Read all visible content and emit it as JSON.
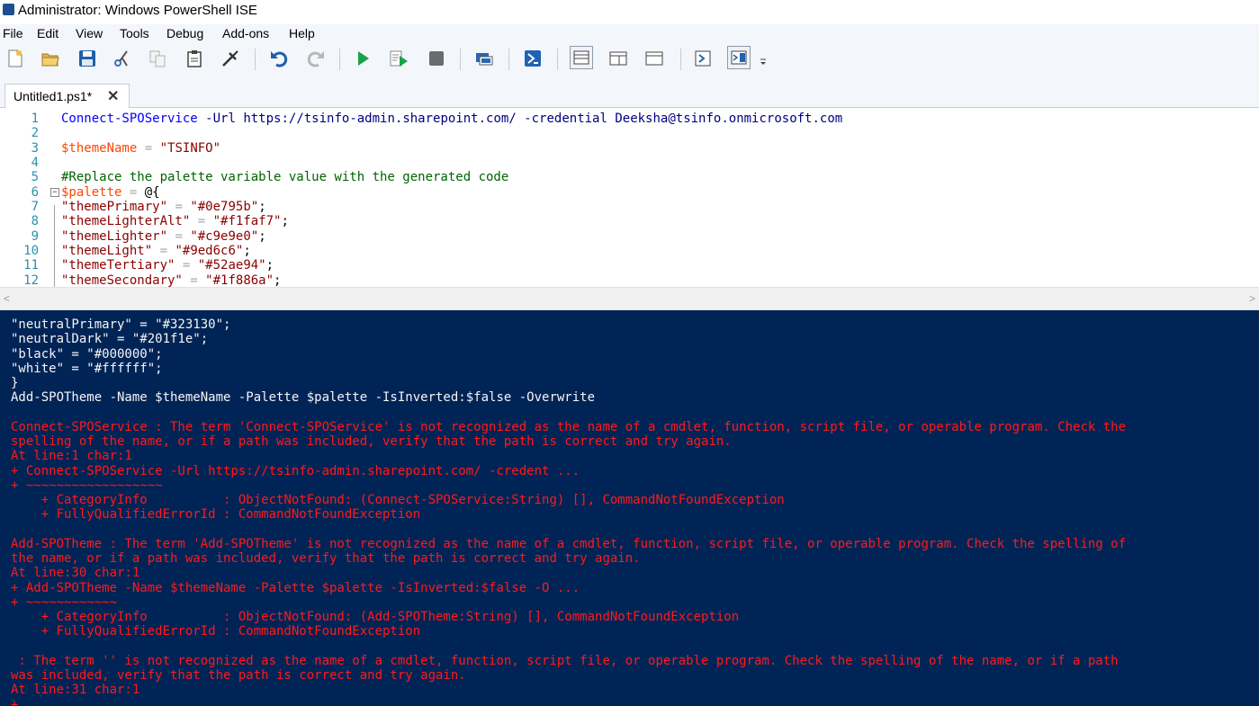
{
  "window": {
    "title": "Administrator: Windows PowerShell ISE"
  },
  "menu": [
    "File",
    "Edit",
    "View",
    "Tools",
    "Debug",
    "Add-ons",
    "Help"
  ],
  "toolbar": {
    "icons": [
      "new-script",
      "open",
      "save",
      "cut",
      "copy",
      "paste",
      "clear-console",
      "undo",
      "redo",
      "run-script",
      "run-selection",
      "stop-operation",
      "new-remote-powershell-tab",
      "start-powershell-exe",
      "show-script-pane-top",
      "show-script-pane-right",
      "show-script-pane-maximized",
      "show-command-window",
      "show-command-add-on",
      "toolbar-overflow"
    ],
    "colors": {
      "run": "#1aa14a",
      "save": "#1f5fa6",
      "stop": "#6b6b6b"
    }
  },
  "tabs": [
    {
      "label": "Untitled1.ps1*",
      "close": "✕"
    }
  ],
  "editor": {
    "colors": {
      "cmdlet": "#0000ff",
      "parameter": "#000080",
      "string": "#8b0000",
      "variable": "#ff4500",
      "comment": "#006400",
      "operator": "#a9a9a9",
      "text": "#000000"
    },
    "lines": [
      {
        "n": "1",
        "tokens": [
          {
            "t": "Connect-SPOService",
            "c": "cmdlet"
          },
          {
            "t": " "
          },
          {
            "t": "-Url",
            "c": "parameter"
          },
          {
            "t": " "
          },
          {
            "t": "https://tsinfo-admin.sharepoint.com/",
            "c": "parameter"
          },
          {
            "t": " "
          },
          {
            "t": "-credential",
            "c": "parameter"
          },
          {
            "t": " "
          },
          {
            "t": "Deeksha@tsinfo.onmicrosoft.com",
            "c": "parameter"
          }
        ]
      },
      {
        "n": "2",
        "tokens": []
      },
      {
        "n": "3",
        "tokens": [
          {
            "t": "$themeName",
            "c": "variable"
          },
          {
            "t": " "
          },
          {
            "t": "=",
            "c": "operator"
          },
          {
            "t": " "
          },
          {
            "t": "\"TSINFO\"",
            "c": "string"
          }
        ]
      },
      {
        "n": "4",
        "tokens": []
      },
      {
        "n": "5",
        "tokens": [
          {
            "t": "#Replace the palette variable value with the generated code",
            "c": "comment"
          }
        ]
      },
      {
        "n": "6",
        "fold": "−",
        "tokens": [
          {
            "t": "$palette",
            "c": "variable"
          },
          {
            "t": " "
          },
          {
            "t": "=",
            "c": "operator"
          },
          {
            "t": " "
          },
          {
            "t": "@{",
            "c": "text"
          }
        ]
      },
      {
        "n": "7",
        "tokens": [
          {
            "t": "\"themePrimary\"",
            "c": "string"
          },
          {
            "t": " "
          },
          {
            "t": "=",
            "c": "operator"
          },
          {
            "t": " "
          },
          {
            "t": "\"#0e795b\"",
            "c": "string"
          },
          {
            "t": ";",
            "c": "text"
          }
        ]
      },
      {
        "n": "8",
        "tokens": [
          {
            "t": "\"themeLighterAlt\"",
            "c": "string"
          },
          {
            "t": " "
          },
          {
            "t": "=",
            "c": "operator"
          },
          {
            "t": " "
          },
          {
            "t": "\"#f1faf7\"",
            "c": "string"
          },
          {
            "t": ";",
            "c": "text"
          }
        ]
      },
      {
        "n": "9",
        "tokens": [
          {
            "t": "\"themeLighter\"",
            "c": "string"
          },
          {
            "t": " "
          },
          {
            "t": "=",
            "c": "operator"
          },
          {
            "t": " "
          },
          {
            "t": "\"#c9e9e0\"",
            "c": "string"
          },
          {
            "t": ";",
            "c": "text"
          }
        ]
      },
      {
        "n": "10",
        "tokens": [
          {
            "t": "\"themeLight\"",
            "c": "string"
          },
          {
            "t": " "
          },
          {
            "t": "=",
            "c": "operator"
          },
          {
            "t": " "
          },
          {
            "t": "\"#9ed6c6\"",
            "c": "string"
          },
          {
            "t": ";",
            "c": "text"
          }
        ]
      },
      {
        "n": "11",
        "tokens": [
          {
            "t": "\"themeTertiary\"",
            "c": "string"
          },
          {
            "t": " "
          },
          {
            "t": "=",
            "c": "operator"
          },
          {
            "t": " "
          },
          {
            "t": "\"#52ae94\"",
            "c": "string"
          },
          {
            "t": ";",
            "c": "text"
          }
        ]
      },
      {
        "n": "12",
        "tokens": [
          {
            "t": "\"themeSecondary\"",
            "c": "string"
          },
          {
            "t": " "
          },
          {
            "t": "=",
            "c": "operator"
          },
          {
            "t": " "
          },
          {
            "t": "\"#1f886a\"",
            "c": "string"
          },
          {
            "t": ";",
            "c": "text"
          }
        ]
      }
    ]
  },
  "console": {
    "colors": {
      "background": "#012456",
      "output": "#f5f5f5",
      "error": "#ff1a1a"
    },
    "lines": [
      {
        "t": "\"neutralPrimary\" = \"#323130\";",
        "k": "w"
      },
      {
        "t": "\"neutralDark\" = \"#201f1e\";",
        "k": "w"
      },
      {
        "t": "\"black\" = \"#000000\";",
        "k": "w"
      },
      {
        "t": "\"white\" = \"#ffffff\";",
        "k": "w"
      },
      {
        "t": "}",
        "k": "w"
      },
      {
        "t": "Add-SPOTheme -Name $themeName -Palette $palette -IsInverted:$false -Overwrite",
        "k": "w"
      },
      {
        "t": "",
        "k": "w"
      },
      {
        "t": "Connect-SPOService : The term 'Connect-SPOService' is not recognized as the name of a cmdlet, function, script file, or operable program. Check the",
        "k": "e"
      },
      {
        "t": "spelling of the name, or if a path was included, verify that the path is correct and try again.",
        "k": "e"
      },
      {
        "t": "At line:1 char:1",
        "k": "e"
      },
      {
        "t": "+ Connect-SPOService -Url https://tsinfo-admin.sharepoint.com/ -credent ...",
        "k": "e"
      },
      {
        "t": "+ ~~~~~~~~~~~~~~~~~~",
        "k": "e"
      },
      {
        "t": "    + CategoryInfo          : ObjectNotFound: (Connect-SPOService:String) [], CommandNotFoundException",
        "k": "e"
      },
      {
        "t": "    + FullyQualifiedErrorId : CommandNotFoundException",
        "k": "e"
      },
      {
        "t": "",
        "k": "e"
      },
      {
        "t": "Add-SPOTheme : The term 'Add-SPOTheme' is not recognized as the name of a cmdlet, function, script file, or operable program. Check the spelling of",
        "k": "e"
      },
      {
        "t": "the name, or if a path was included, verify that the path is correct and try again.",
        "k": "e"
      },
      {
        "t": "At line:30 char:1",
        "k": "e"
      },
      {
        "t": "+ Add-SPOTheme -Name $themeName -Palette $palette -IsInverted:$false -O ...",
        "k": "e"
      },
      {
        "t": "+ ~~~~~~~~~~~~",
        "k": "e"
      },
      {
        "t": "    + CategoryInfo          : ObjectNotFound: (Add-SPOTheme:String) [], CommandNotFoundException",
        "k": "e"
      },
      {
        "t": "    + FullyQualifiedErrorId : CommandNotFoundException",
        "k": "e"
      },
      {
        "t": "",
        "k": "e"
      },
      {
        "t": " : The term '' is not recognized as the name of a cmdlet, function, script file, or operable program. Check the spelling of the name, or if a path",
        "k": "e"
      },
      {
        "t": "was included, verify that the path is correct and try again.",
        "k": "e"
      },
      {
        "t": "At line:31 char:1",
        "k": "e"
      },
      {
        "t": "+",
        "k": "e"
      }
    ]
  }
}
